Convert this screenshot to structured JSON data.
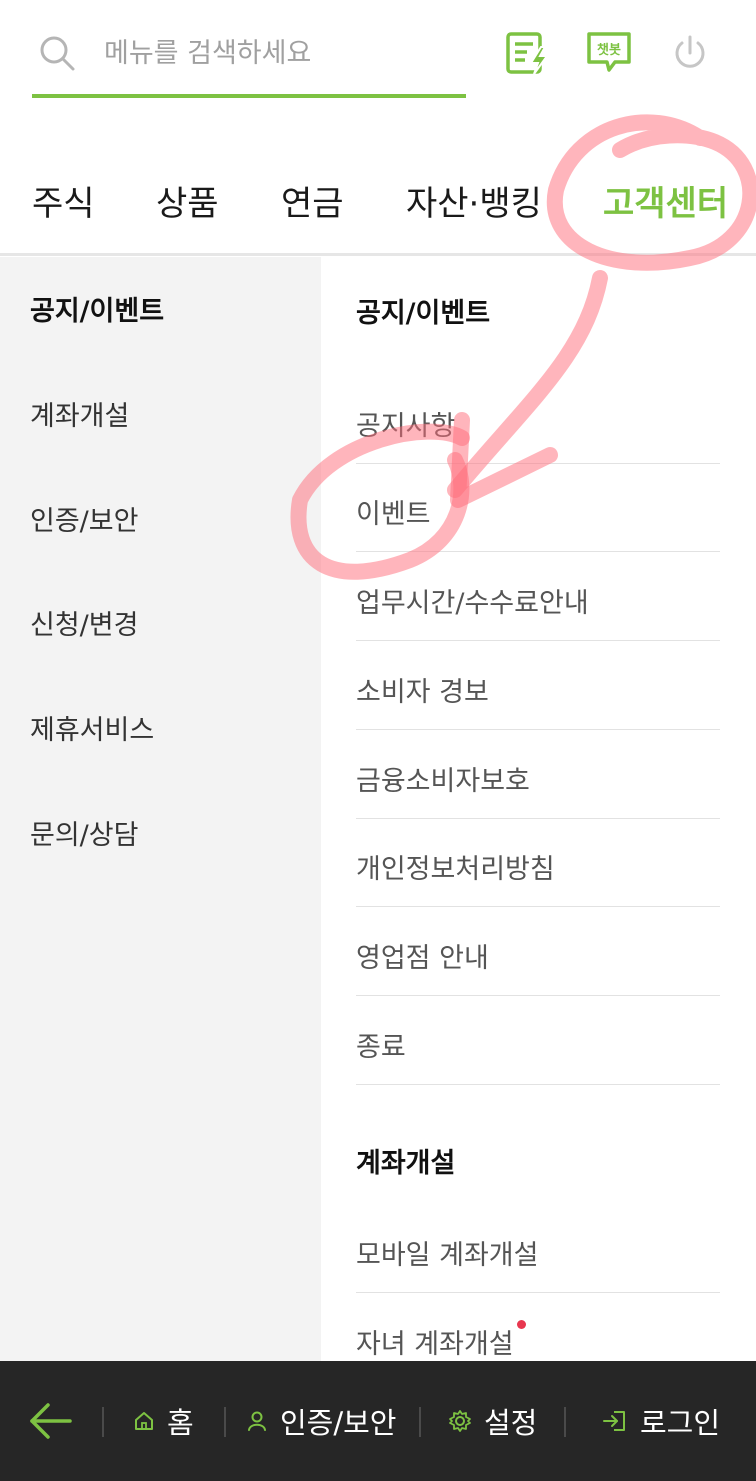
{
  "search": {
    "placeholder": "메뉴를 검색하세요"
  },
  "header_icons": {
    "memo": "memo-lightning-icon",
    "chatbot_label": "챗봇",
    "power": "power-icon"
  },
  "tabs": [
    {
      "label": "주식"
    },
    {
      "label": "상품"
    },
    {
      "label": "연금"
    },
    {
      "label": "자산·뱅킹"
    },
    {
      "label": "고객센터",
      "active": true
    }
  ],
  "categories": [
    "공지/이벤트",
    "계좌개설",
    "인증/보안",
    "신청/변경",
    "제휴서비스",
    "문의/상담"
  ],
  "sections": [
    {
      "title": "공지/이벤트",
      "items": [
        "공지사항",
        "이벤트",
        "업무시간/수수료안내",
        "소비자 경보",
        "금융소비자보호",
        "개인정보처리방침",
        "영업점 안내",
        "종료"
      ]
    },
    {
      "title": "계좌개설",
      "items": [
        "모바일 계좌개설",
        "자녀 계좌개설"
      ]
    }
  ],
  "bottom_bar": {
    "home": "홈",
    "auth": "인증/보안",
    "settings": "설정",
    "login": "로그인"
  },
  "colors": {
    "accent": "#7dc242",
    "bottom_bar": "#262626",
    "left_bg": "#f3f3f3",
    "annotation": "#ff6b7a",
    "new_dot": "#e8374f"
  }
}
